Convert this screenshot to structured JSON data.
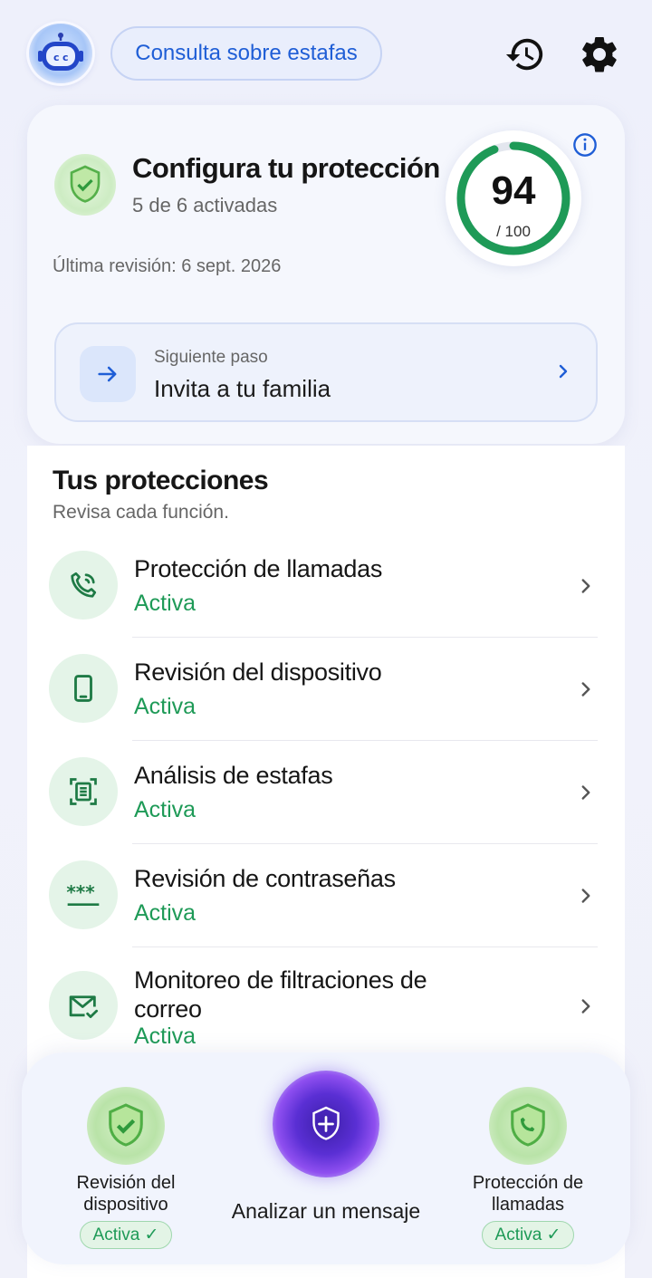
{
  "header": {
    "avatar_icon": "robot-assistant-icon",
    "scam_query_label": "Consulta sobre estafas",
    "history_icon": "history-icon",
    "settings_icon": "gear-icon"
  },
  "summary": {
    "title": "Configura tu protección",
    "subtitle": "5 de 6 activadas",
    "last_review": "Última revisión: 6 sept. 2026",
    "score": "94",
    "score_max": "/ 100",
    "score_fraction": 0.94,
    "next_step": {
      "label": "Siguiente paso",
      "title": "Invita a tu familia"
    }
  },
  "protections": {
    "title": "Tus protecciones",
    "subtitle": "Revisa cada función.",
    "items": [
      {
        "name": "Protección de llamadas",
        "status": "Activa",
        "icon": "phone-shield-icon"
      },
      {
        "name": "Revisión del dispositivo",
        "status": "Activa",
        "icon": "smartphone-icon"
      },
      {
        "name": "Análisis de estafas",
        "status": "Activa",
        "icon": "document-scan-icon"
      },
      {
        "name": "Revisión de contraseñas",
        "status": "Activa",
        "icon": "password-icon"
      },
      {
        "name": "Monitoreo de filtraciones de correo",
        "status": "Activa",
        "icon": "mail-check-icon"
      }
    ]
  },
  "dock": {
    "left": {
      "label_line1": "Revisión del",
      "label_line2": "dispositivo",
      "badge": "Activa ✓"
    },
    "center": {
      "label": "Analizar un mensaje"
    },
    "right": {
      "label_line1": "Protección de",
      "label_line2": "llamadas",
      "badge": "Activa ✓"
    }
  },
  "colors": {
    "accent_blue": "#1f5ed6",
    "active_green": "#1e9a57",
    "ring_green": "#1e9a57"
  }
}
